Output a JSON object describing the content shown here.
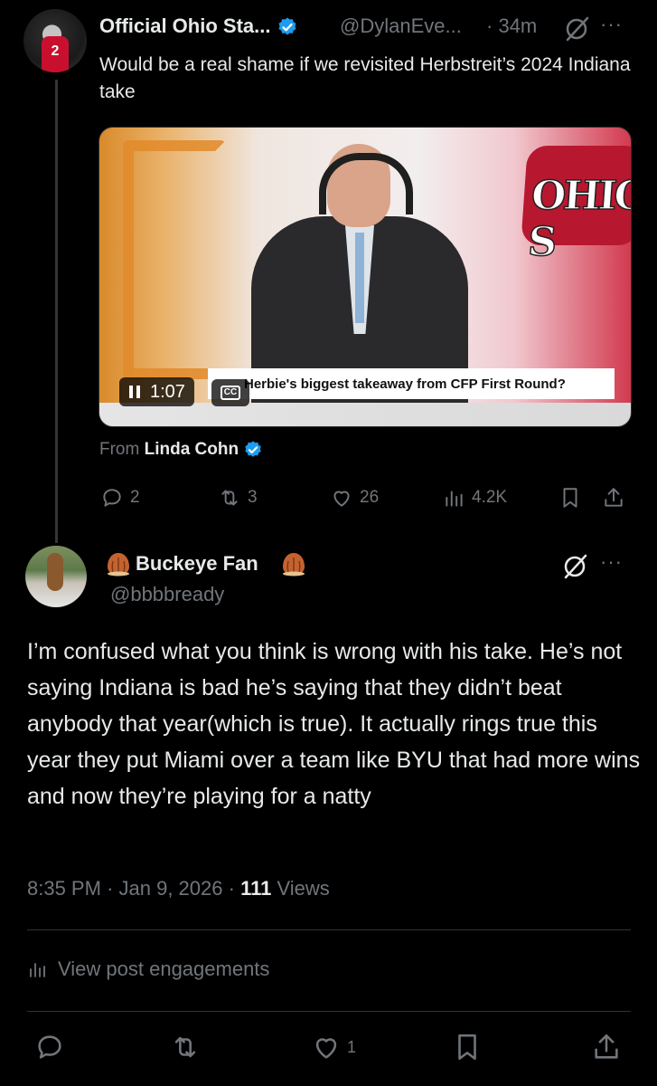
{
  "parent_tweet": {
    "display_name": "Official Ohio Sta...",
    "handle": "@DylanEve...",
    "separator": "·",
    "timestamp": "34m",
    "more": "···",
    "text": "Would be a real shame if we revisited Herbstreit’s 2024 Indiana take",
    "avatar_jersey_number": "2",
    "video": {
      "duration": "1:07",
      "caption_label": "CC",
      "lower_third": "Herbie's biggest takeaway from CFP First Round?",
      "logo_text": "OHIO S"
    },
    "from_prefix": "From",
    "from_name": "Linda Cohn",
    "stats": {
      "replies": "2",
      "reposts": "3",
      "likes": "26",
      "views": "4.2K"
    }
  },
  "reply_tweet": {
    "display_name": "Buckeye Fan",
    "handle": "@bbbbready",
    "more": "···",
    "text": "I’m confused what you think is wrong with his take. He’s not saying Indiana is bad he’s saying that they didn’t beat anybody that year(which is true). It actually rings true this year they put Miami over a team like BYU that had more wins and now they’re playing for a natty",
    "time": "8:35 PM",
    "date": "Jan 9, 2026",
    "separator": "·",
    "views_count": "111",
    "views_label": "Views",
    "engagements_label": "View post engagements",
    "likes": "1"
  },
  "colors": {
    "background": "#000000",
    "text": "#e7e9ea",
    "muted": "#71767b",
    "verified": "#1d9bf0",
    "divider": "#2f3336"
  },
  "icons": [
    "verified-badge-icon",
    "grok-icon",
    "more-icon",
    "reply-icon",
    "repost-icon",
    "like-icon",
    "views-icon",
    "bookmark-icon",
    "share-icon",
    "pause-icon",
    "captions-icon",
    "nut-emoji-icon",
    "engagements-icon"
  ]
}
